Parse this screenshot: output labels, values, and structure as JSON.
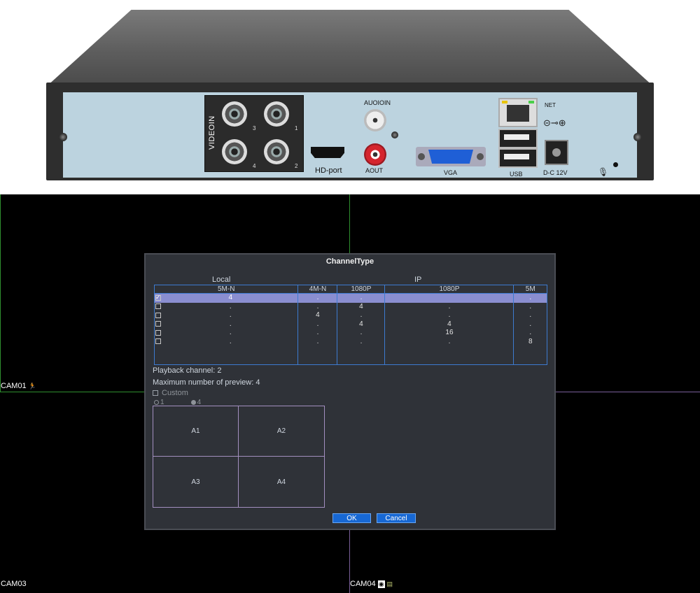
{
  "device": {
    "label_videoin": "VIDEOIN",
    "bnc_numbers": [
      "3",
      "1",
      "4",
      "2"
    ],
    "label_hdport": "HD-port",
    "label_audioin": "AUOIOIN",
    "label_aout": "AOUT",
    "label_vga": "VGA",
    "label_net": "NET",
    "label_usb": "USB",
    "label_dc": "D-C 12V"
  },
  "cameras": {
    "cam1": "CAM01",
    "cam3": "CAM03",
    "cam4": "CAM04"
  },
  "dialog": {
    "title": "ChannelType",
    "group_local": "Local",
    "group_ip": "IP",
    "columns": [
      "5M-N",
      "4M-N",
      "1080P",
      "1080P",
      "5M"
    ],
    "rows": [
      {
        "checked": true,
        "selected": true,
        "cells": [
          "4",
          ".",
          ".",
          "",
          "."
        ]
      },
      {
        "checked": false,
        "selected": false,
        "cells": [
          ".",
          ".",
          "4",
          ".",
          "."
        ]
      },
      {
        "checked": false,
        "selected": false,
        "cells": [
          ".",
          "4",
          ".",
          ".",
          "."
        ]
      },
      {
        "checked": false,
        "selected": false,
        "cells": [
          ".",
          ".",
          "4",
          "4",
          "."
        ]
      },
      {
        "checked": false,
        "selected": false,
        "cells": [
          ".",
          ".",
          ".",
          "16",
          "."
        ]
      },
      {
        "checked": false,
        "selected": false,
        "cells": [
          ".",
          ".",
          ".",
          ".",
          "8"
        ]
      }
    ],
    "playback": "Playback channel: 2",
    "max_preview": "Maximum number of preview: 4",
    "custom_label": "Custom",
    "radio_options": [
      "1",
      "4"
    ],
    "radio_selected": "4",
    "preview_cells": [
      "A1",
      "A2",
      "A3",
      "A4"
    ],
    "ok_label": "OK",
    "cancel_label": "Cancel"
  },
  "colors": {
    "dialog_bg": "#2f3238",
    "table_border": "#3d7bd0",
    "selected_row": "#8a8ed0",
    "button": "#1768d4",
    "grid_green": "#2f8f2f",
    "grid_purple": "#7a5f9a"
  }
}
